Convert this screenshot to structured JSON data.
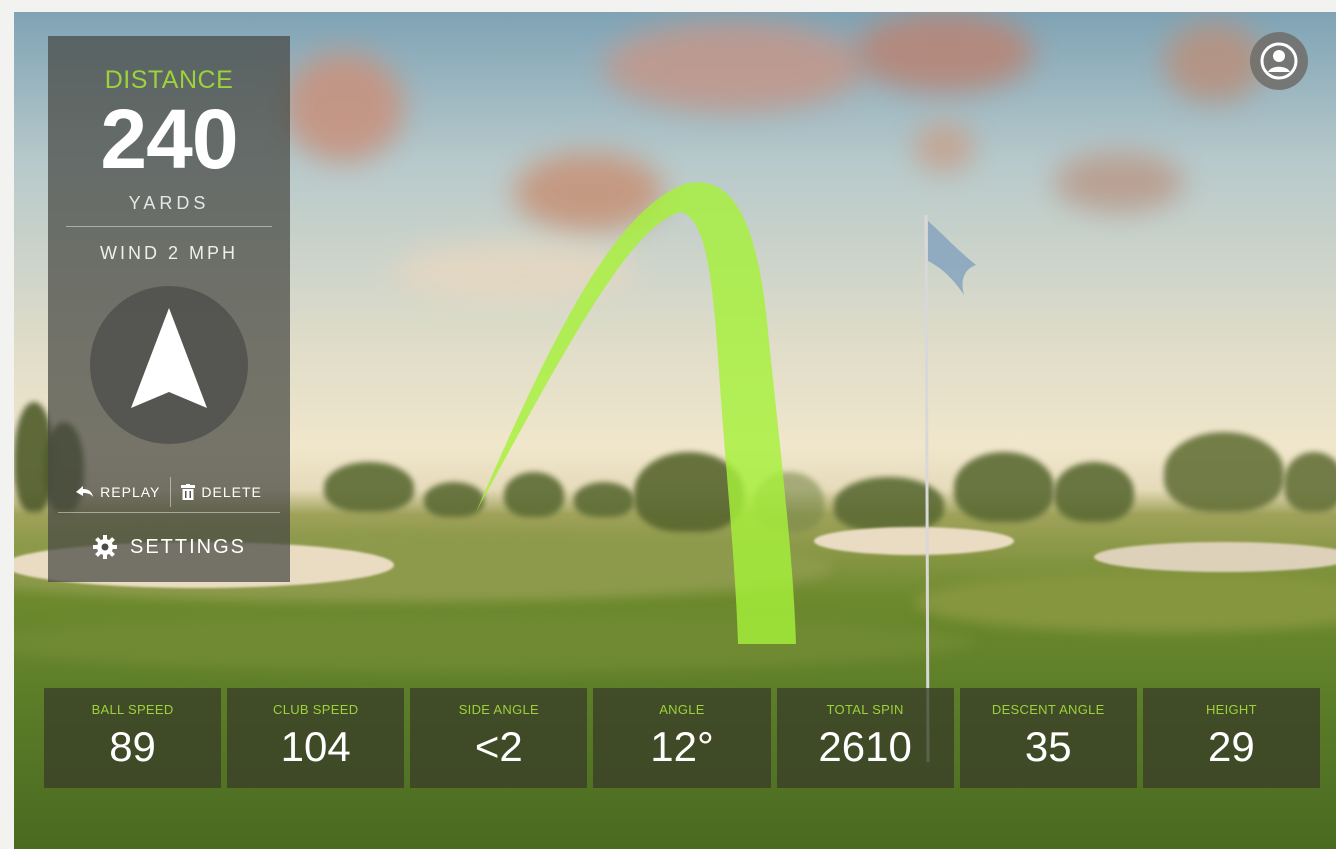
{
  "distance": {
    "label": "DISTANCE",
    "value": "240",
    "unit": "YARDS"
  },
  "wind": {
    "label": "WIND 2 MPH",
    "direction_icon": "wind-arrow-icon"
  },
  "actions": {
    "replay_label": "REPLAY",
    "delete_label": "DELETE",
    "settings_label": "SETTINGS"
  },
  "profile": {
    "icon": "user-profile-icon"
  },
  "stats": [
    {
      "label": "BALL SPEED",
      "value": "89"
    },
    {
      "label": "CLUB SPEED",
      "value": "104"
    },
    {
      "label": "SIDE ANGLE",
      "value": "<2"
    },
    {
      "label": "ANGLE",
      "value": "12°"
    },
    {
      "label": "TOTAL SPIN",
      "value": "2610"
    },
    {
      "label": "DESCENT ANGLE",
      "value": "35"
    },
    {
      "label": "HEIGHT",
      "value": "29"
    }
  ],
  "colors": {
    "accent": "#9cd23a",
    "trajectory": "#a6f03a",
    "panel": "#46483f"
  }
}
